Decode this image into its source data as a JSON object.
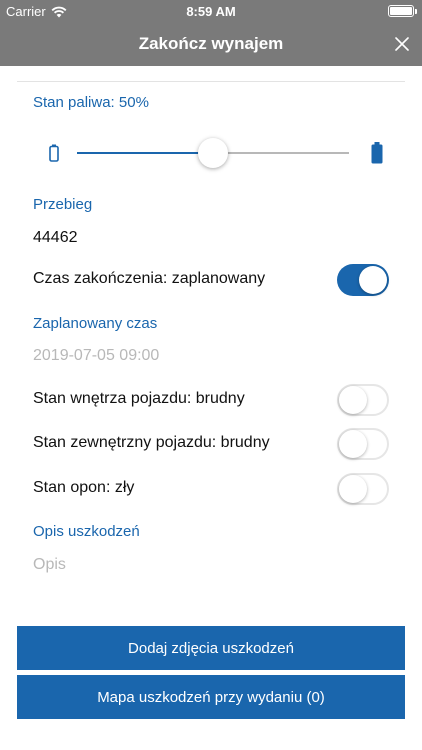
{
  "statusbar": {
    "carrier": "Carrier",
    "time": "8:59 AM"
  },
  "navbar": {
    "title": "Zakończ wynajem"
  },
  "fuel": {
    "label": "Stan paliwa: 50%",
    "level": 0.5
  },
  "mileage": {
    "label": "Przebieg",
    "value": "44462"
  },
  "end_time": {
    "label": "Czas zakończenia: zaplanowany",
    "on": true
  },
  "planned": {
    "label": "Zaplanowany czas",
    "value": "2019-07-05 09:00"
  },
  "interior": {
    "label": "Stan wnętrza pojazdu: brudny",
    "on": false
  },
  "exterior": {
    "label": "Stan zewnętrzny pojazdu: brudny",
    "on": false
  },
  "tires": {
    "label": "Stan opon: zły",
    "on": false
  },
  "damage": {
    "label": "Opis uszkodzeń",
    "placeholder": "Opis"
  },
  "buttons": {
    "add_photos": "Dodaj zdjęcia uszkodzeń",
    "damage_map": "Mapa uszkodzeń przy wydaniu (0)"
  },
  "colors": {
    "accent": "#1a66ad",
    "bar": "#7a7a7a"
  }
}
